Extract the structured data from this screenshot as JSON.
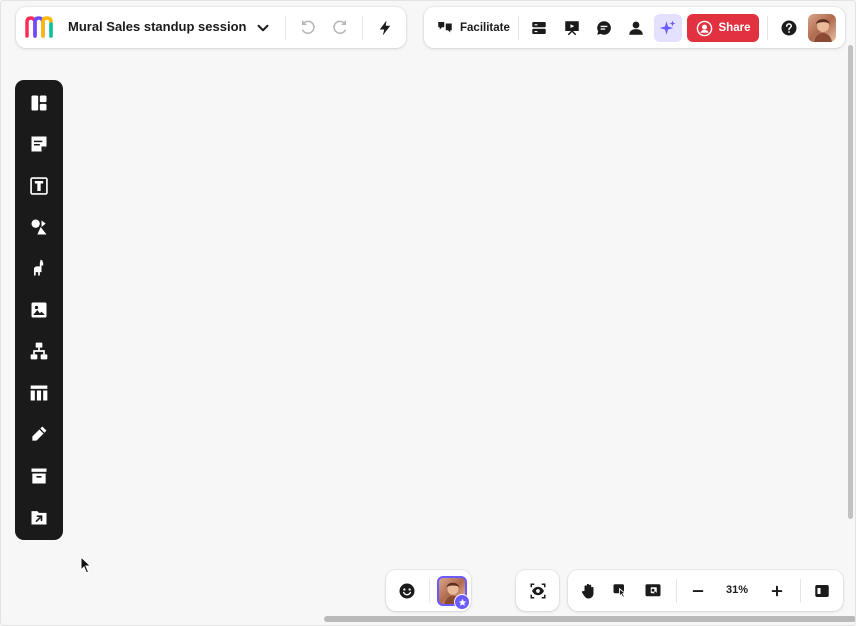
{
  "header": {
    "mural_title": "Mural Sales standup session",
    "facilitate_label": "Facilitate",
    "share_label": "Share"
  },
  "left_toolbar": {
    "tools": [
      "templates-icon",
      "sticky-note-icon",
      "text-icon",
      "shapes-icon",
      "icons-llama-icon",
      "image-icon",
      "diagram-icon",
      "table-icon",
      "draw-pencil-icon",
      "archive-icon",
      "upload-icon"
    ]
  },
  "bottom": {
    "zoom_level": "31%"
  },
  "colors": {
    "share": "#e2323f",
    "ai_bg": "#e4e0ff",
    "ai_icon": "#6b5bff",
    "toolbar_dark": "#1a1a1a",
    "canvas": "#f7f7f7"
  }
}
